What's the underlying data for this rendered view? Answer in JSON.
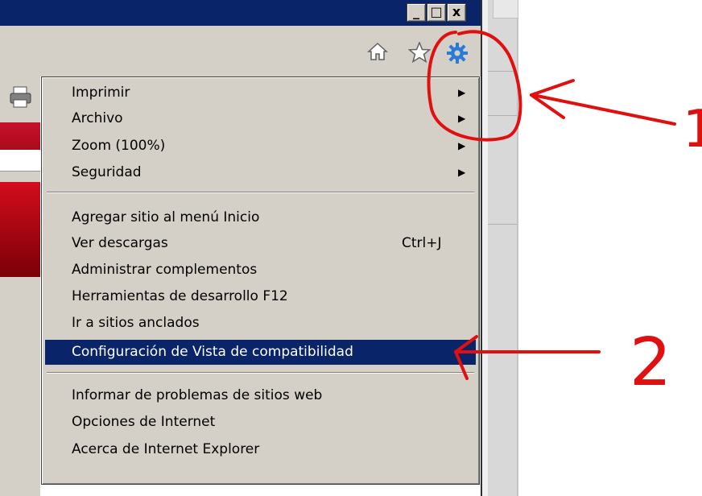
{
  "window": {
    "min_label": "_",
    "max_label": "□",
    "close_label": "x"
  },
  "toolbar": {
    "home_icon": "home-icon",
    "favorites_icon": "star-icon",
    "tools_icon": "gear-icon",
    "print_icon": "print-icon"
  },
  "menu": {
    "items": [
      {
        "label": "Imprimir",
        "shortcut": "",
        "submenu": "▶"
      },
      {
        "label": "Archivo",
        "shortcut": "",
        "submenu": "▶"
      },
      {
        "label": "Zoom (100%)",
        "shortcut": "",
        "submenu": "▶"
      },
      {
        "label": "Seguridad",
        "shortcut": "",
        "submenu": "▶"
      },
      {
        "label": "Agregar sitio al menú Inicio",
        "shortcut": ""
      },
      {
        "label": "Ver descargas",
        "shortcut": "Ctrl+J"
      },
      {
        "label": "Administrar complementos",
        "shortcut": ""
      },
      {
        "label": "Herramientas de desarrollo F12",
        "shortcut": ""
      },
      {
        "label": "Ir a sitios anclados",
        "shortcut": ""
      },
      {
        "label": "Configuración de Vista de compatibilidad",
        "shortcut": "",
        "highlighted": true
      },
      {
        "label": "Informar de problemas de sitios web",
        "shortcut": ""
      },
      {
        "label": "Opciones de Internet",
        "shortcut": ""
      },
      {
        "label": "Acerca de Internet Explorer",
        "shortcut": ""
      }
    ]
  },
  "annotations": {
    "label_1": "1",
    "label_2": "2",
    "ink_color": "#e01010"
  }
}
